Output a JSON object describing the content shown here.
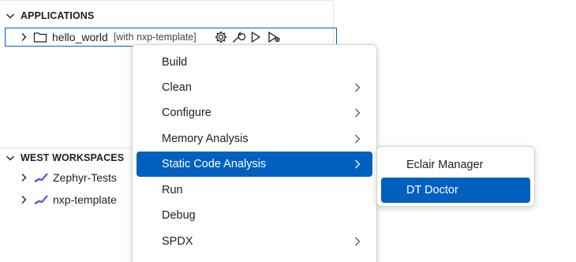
{
  "sidebar": {
    "applications_header": "APPLICATIONS",
    "app_row": {
      "label": "hello_world",
      "description": "[with nxp-template]",
      "actions": [
        "gear-icon",
        "wrench-icon",
        "run-icon",
        "debug-icon"
      ]
    },
    "west_header": "WEST WORKSPACES",
    "workspaces": [
      {
        "label": "Zephyr-Tests"
      },
      {
        "label": "nxp-template"
      }
    ]
  },
  "context_menu": {
    "items": [
      {
        "label": "Build",
        "has_submenu": false
      },
      {
        "label": "Clean",
        "has_submenu": true
      },
      {
        "label": "Configure",
        "has_submenu": true
      },
      {
        "label": "Memory Analysis",
        "has_submenu": true
      },
      {
        "label": "Static Code Analysis",
        "has_submenu": true,
        "active": true
      },
      {
        "label": "Run",
        "has_submenu": false
      },
      {
        "label": "Debug",
        "has_submenu": false
      },
      {
        "label": "SPDX",
        "has_submenu": true
      }
    ]
  },
  "submenu": {
    "items": [
      {
        "label": "Eclair Manager"
      },
      {
        "label": "DT Doctor",
        "active": true
      }
    ]
  },
  "colors": {
    "accent": "#0060c0",
    "zephyr_icon": "#7b3fe4"
  }
}
